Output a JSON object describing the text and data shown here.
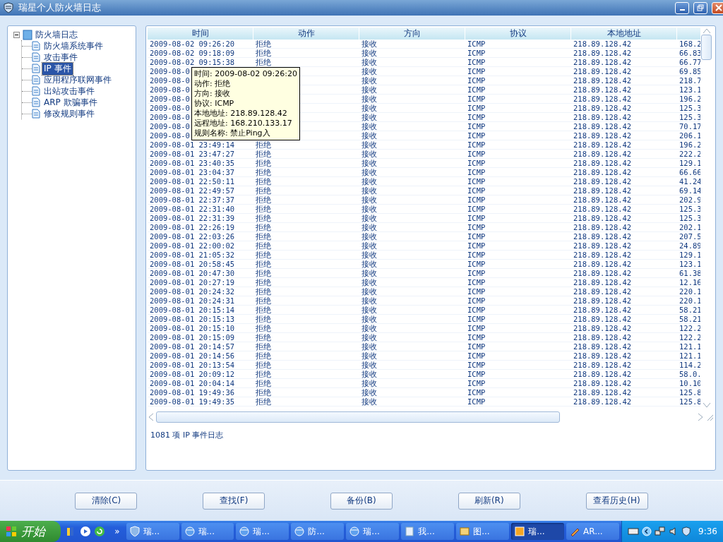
{
  "window": {
    "title": "瑞星个人防火墙日志"
  },
  "tree": {
    "label": "防火墙日志",
    "expanded": true,
    "children": [
      {
        "label": "防火墙系统事件",
        "selected": false
      },
      {
        "label": "攻击事件",
        "selected": false
      },
      {
        "label": "IP 事件",
        "selected": true
      },
      {
        "label": "应用程序联网事件",
        "selected": false
      },
      {
        "label": "出站攻击事件",
        "selected": false
      },
      {
        "label": "ARP 欺骗事件",
        "selected": false
      },
      {
        "label": "修改规则事件",
        "selected": false
      }
    ]
  },
  "table": {
    "columns": [
      "时间",
      "动作",
      "方向",
      "协议",
      "本地地址"
    ],
    "rows": [
      {
        "time": "2009-08-02 09:26:20",
        "action": "拒绝",
        "direction": "接收",
        "protocol": "ICMP",
        "local": "218.89.128.42",
        "remote": "168.2"
      },
      {
        "time": "2009-08-02 09:18:09",
        "action": "拒绝",
        "direction": "接收",
        "protocol": "ICMP",
        "local": "218.89.128.42",
        "remote": "66.83"
      },
      {
        "time": "2009-08-02 09:15:38",
        "action": "拒绝",
        "direction": "接收",
        "protocol": "ICMP",
        "local": "218.89.128.42",
        "remote": "66.77"
      },
      {
        "time": "2009-08-0",
        "direction": "接收",
        "protocol": "ICMP",
        "local": "218.89.128.42",
        "remote": "69.85"
      },
      {
        "time": "2009-08-0",
        "direction": "接收",
        "protocol": "ICMP",
        "local": "218.89.128.42",
        "remote": "218.7"
      },
      {
        "time": "2009-08-0",
        "direction": "接收",
        "protocol": "ICMP",
        "local": "218.89.128.42",
        "remote": "123.1"
      },
      {
        "time": "2009-08-0",
        "direction": "接收",
        "protocol": "ICMP",
        "local": "218.89.128.42",
        "remote": "196.2"
      },
      {
        "time": "2009-08-0",
        "direction": "接收",
        "protocol": "ICMP",
        "local": "218.89.128.42",
        "remote": "125.3"
      },
      {
        "time": "2009-08-0",
        "direction": "接收",
        "protocol": "ICMP",
        "local": "218.89.128.42",
        "remote": "125.3"
      },
      {
        "time": "2009-08-0",
        "direction": "接收",
        "protocol": "ICMP",
        "local": "218.89.128.42",
        "remote": "70.17"
      },
      {
        "time": "2009-08-0",
        "direction": "接收",
        "protocol": "ICMP",
        "local": "218.89.128.42",
        "remote": "206.1"
      },
      {
        "time": "2009-08-01 23:49:14",
        "action": "拒绝",
        "direction": "接收",
        "protocol": "ICMP",
        "local": "218.89.128.42",
        "remote": "196.2"
      },
      {
        "time": "2009-08-01 23:47:27",
        "action": "拒绝",
        "direction": "接收",
        "protocol": "ICMP",
        "local": "218.89.128.42",
        "remote": "222.2"
      },
      {
        "time": "2009-08-01 23:40:35",
        "action": "拒绝",
        "direction": "接收",
        "protocol": "ICMP",
        "local": "218.89.128.42",
        "remote": "129.1"
      },
      {
        "time": "2009-08-01 23:04:37",
        "action": "拒绝",
        "direction": "接收",
        "protocol": "ICMP",
        "local": "218.89.128.42",
        "remote": "66.66"
      },
      {
        "time": "2009-08-01 22:50:11",
        "action": "拒绝",
        "direction": "接收",
        "protocol": "ICMP",
        "local": "218.89.128.42",
        "remote": "41.24"
      },
      {
        "time": "2009-08-01 22:49:57",
        "action": "拒绝",
        "direction": "接收",
        "protocol": "ICMP",
        "local": "218.89.128.42",
        "remote": "69.14"
      },
      {
        "time": "2009-08-01 22:37:37",
        "action": "拒绝",
        "direction": "接收",
        "protocol": "ICMP",
        "local": "218.89.128.42",
        "remote": "202.9"
      },
      {
        "time": "2009-08-01 22:31:40",
        "action": "拒绝",
        "direction": "接收",
        "protocol": "ICMP",
        "local": "218.89.128.42",
        "remote": "125.3"
      },
      {
        "time": "2009-08-01 22:31:39",
        "action": "拒绝",
        "direction": "接收",
        "protocol": "ICMP",
        "local": "218.89.128.42",
        "remote": "125.3"
      },
      {
        "time": "2009-08-01 22:26:19",
        "action": "拒绝",
        "direction": "接收",
        "protocol": "ICMP",
        "local": "218.89.128.42",
        "remote": "202.1"
      },
      {
        "time": "2009-08-01 22:03:26",
        "action": "拒绝",
        "direction": "接收",
        "protocol": "ICMP",
        "local": "218.89.128.42",
        "remote": "207.5"
      },
      {
        "time": "2009-08-01 22:00:02",
        "action": "拒绝",
        "direction": "接收",
        "protocol": "ICMP",
        "local": "218.89.128.42",
        "remote": "24.89"
      },
      {
        "time": "2009-08-01 21:05:32",
        "action": "拒绝",
        "direction": "接收",
        "protocol": "ICMP",
        "local": "218.89.128.42",
        "remote": "129.1"
      },
      {
        "time": "2009-08-01 20:58:45",
        "action": "拒绝",
        "direction": "接收",
        "protocol": "ICMP",
        "local": "218.89.128.42",
        "remote": "123.1"
      },
      {
        "time": "2009-08-01 20:47:30",
        "action": "拒绝",
        "direction": "接收",
        "protocol": "ICMP",
        "local": "218.89.128.42",
        "remote": "61.38"
      },
      {
        "time": "2009-08-01 20:27:19",
        "action": "拒绝",
        "direction": "接收",
        "protocol": "ICMP",
        "local": "218.89.128.42",
        "remote": "12.16"
      },
      {
        "time": "2009-08-01 20:24:32",
        "action": "拒绝",
        "direction": "接收",
        "protocol": "ICMP",
        "local": "218.89.128.42",
        "remote": "220.1"
      },
      {
        "time": "2009-08-01 20:24:31",
        "action": "拒绝",
        "direction": "接收",
        "protocol": "ICMP",
        "local": "218.89.128.42",
        "remote": "220.1"
      },
      {
        "time": "2009-08-01 20:15:14",
        "action": "拒绝",
        "direction": "接收",
        "protocol": "ICMP",
        "local": "218.89.128.42",
        "remote": "58.21"
      },
      {
        "time": "2009-08-01 20:15:13",
        "action": "拒绝",
        "direction": "接收",
        "protocol": "ICMP",
        "local": "218.89.128.42",
        "remote": "58.21"
      },
      {
        "time": "2009-08-01 20:15:10",
        "action": "拒绝",
        "direction": "接收",
        "protocol": "ICMP",
        "local": "218.89.128.42",
        "remote": "122.2"
      },
      {
        "time": "2009-08-01 20:15:09",
        "action": "拒绝",
        "direction": "接收",
        "protocol": "ICMP",
        "local": "218.89.128.42",
        "remote": "122.2"
      },
      {
        "time": "2009-08-01 20:14:57",
        "action": "拒绝",
        "direction": "接收",
        "protocol": "ICMP",
        "local": "218.89.128.42",
        "remote": "121.1"
      },
      {
        "time": "2009-08-01 20:14:56",
        "action": "拒绝",
        "direction": "接收",
        "protocol": "ICMP",
        "local": "218.89.128.42",
        "remote": "121.1"
      },
      {
        "time": "2009-08-01 20:13:54",
        "action": "拒绝",
        "direction": "接收",
        "protocol": "ICMP",
        "local": "218.89.128.42",
        "remote": "114.2"
      },
      {
        "time": "2009-08-01 20:09:12",
        "action": "拒绝",
        "direction": "接收",
        "protocol": "ICMP",
        "local": "218.89.128.42",
        "remote": "58.0."
      },
      {
        "time": "2009-08-01 20:04:14",
        "action": "拒绝",
        "direction": "接收",
        "protocol": "ICMP",
        "local": "218.89.128.42",
        "remote": "10.10"
      },
      {
        "time": "2009-08-01 19:49:36",
        "action": "拒绝",
        "direction": "接收",
        "protocol": "ICMP",
        "local": "218.89.128.42",
        "remote": "125.8"
      },
      {
        "time": "2009-08-01 19:49:35",
        "action": "拒绝",
        "direction": "接收",
        "protocol": "ICMP",
        "local": "218.89.128.42",
        "remote": "125.8"
      }
    ]
  },
  "tooltip": [
    "时间: 2009-08-02 09:26:20",
    "动作: 拒绝",
    "方向: 接收",
    "协议: ICMP",
    "本地地址: 218.89.128.42",
    "远程地址: 168.210.133.17",
    "规则名称: 禁止Ping入"
  ],
  "status": "1081 项 IP 事件日志",
  "buttons": [
    "清除(C)",
    "查找(F)",
    "备份(B)",
    "刷新(R)",
    "查看历史(H)"
  ],
  "taskbar": {
    "start": "开始",
    "more": "»",
    "tasks": [
      {
        "label": "瑞...",
        "kind": "shield",
        "selected": false
      },
      {
        "label": "瑞...",
        "kind": "ie",
        "selected": false
      },
      {
        "label": "瑞...",
        "kind": "ie",
        "selected": false
      },
      {
        "label": "防...",
        "kind": "ie",
        "selected": false
      },
      {
        "label": "瑞...",
        "kind": "ie",
        "selected": false
      },
      {
        "label": "我...",
        "kind": "doc",
        "selected": false
      },
      {
        "label": "图...",
        "kind": "image",
        "selected": false
      },
      {
        "label": "瑞...",
        "kind": "app",
        "selected": true
      },
      {
        "label": "AR...",
        "kind": "tool",
        "selected": false
      }
    ],
    "clock": "9:36"
  }
}
